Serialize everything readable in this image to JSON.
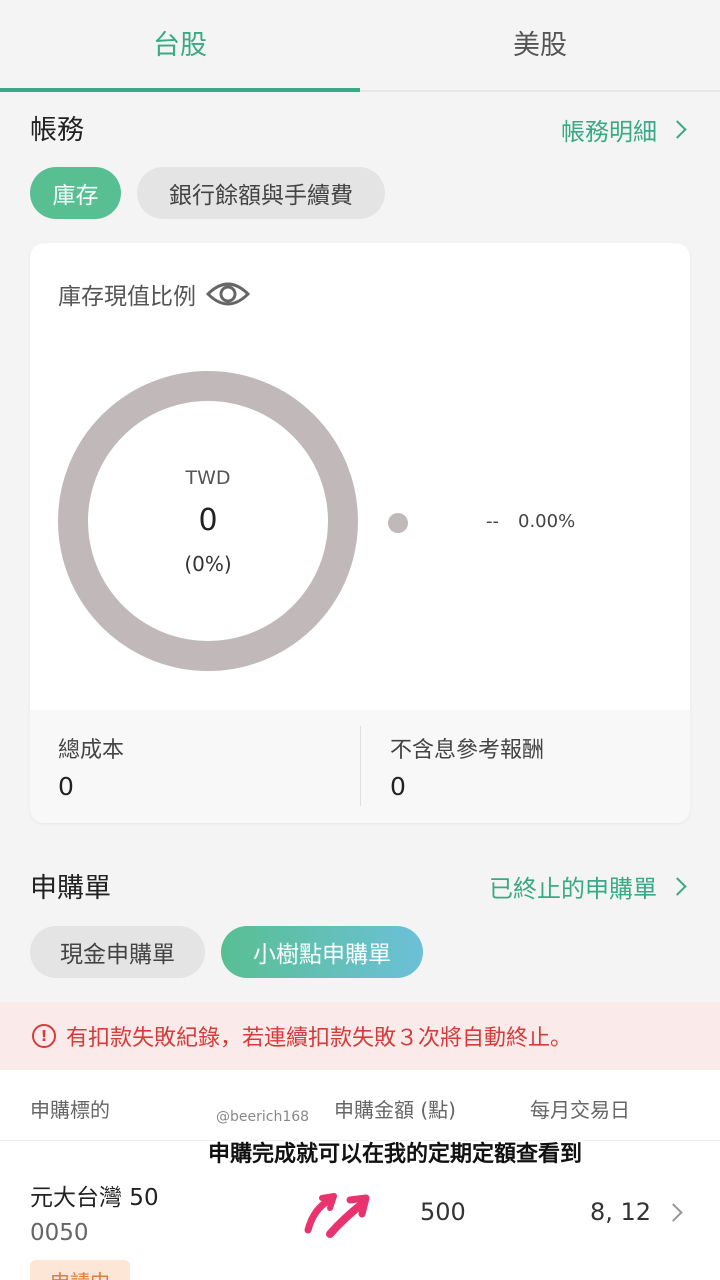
{
  "tabs": [
    {
      "label": "台股",
      "active": true
    },
    {
      "label": "美股",
      "active": false
    }
  ],
  "account": {
    "title": "帳務",
    "link": "帳務明細",
    "pills": [
      "庫存",
      "銀行餘額與手續費"
    ]
  },
  "card": {
    "title": "庫存現值比例",
    "currency": "TWD",
    "total": "0",
    "percent": "(0%)",
    "legend_name": "--",
    "legend_pct": "0.00%",
    "cost_label": "總成本",
    "cost_value": "0",
    "return_label": "不含息參考報酬",
    "return_value": "0"
  },
  "subscription": {
    "title": "申購單",
    "link": "已終止的申購單",
    "pills": [
      "現金申購單",
      "小樹點申購單"
    ],
    "warning": "有扣款失敗紀錄，若連續扣款失敗３次將自動終止。",
    "headers": [
      "申購標的",
      "申購金額 (點)",
      "每月交易日"
    ],
    "row": {
      "name": "元大台灣 50",
      "code": "0050",
      "amount": "500",
      "days": "8, 12",
      "status": "申請中"
    }
  },
  "overlay": {
    "watermark": "@beerich168",
    "subtitle": "申購完成就可以在我的定期定額查看到"
  },
  "colors": {
    "accent": "#3aa985",
    "donut": "#c1b9b9",
    "warning": "#d63b3b",
    "arrow": "#e8336e"
  }
}
